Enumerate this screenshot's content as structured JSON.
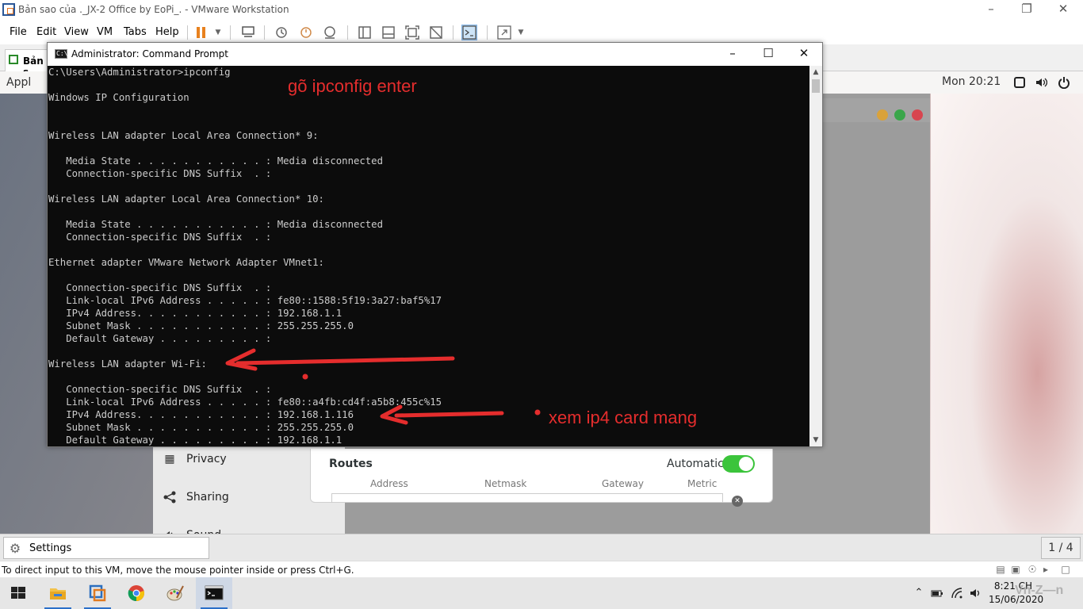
{
  "vmware": {
    "title": "Bản sao của ._JX-2 Office by EoPi_. - VMware Workstation",
    "menu": [
      "File",
      "Edit",
      "View",
      "VM",
      "Tabs",
      "Help"
    ],
    "vm_tab_label": "Bản s",
    "status_text": "To direct input to this VM, move the mouse pointer inside or press Ctrl+G."
  },
  "guest": {
    "activities": "Appl",
    "clock": "Mon 20:21",
    "settings": {
      "sidebar": [
        {
          "label": "Privacy",
          "icon": "privacy-icon"
        },
        {
          "label": "Sharing",
          "icon": "share-icon"
        },
        {
          "label": "Sound",
          "icon": "sound-icon"
        }
      ],
      "routes": {
        "title": "Routes",
        "automatic_label": "Automatic",
        "automatic_on": true,
        "columns": [
          "Address",
          "Netmask",
          "Gateway",
          "Metric"
        ]
      }
    },
    "taskbar": {
      "item_label": "Settings",
      "pager": "1 / 4"
    }
  },
  "cmd": {
    "title": "Administrator: Command Prompt",
    "lines": [
      "C:\\Users\\Administrator>ipconfig",
      "",
      "Windows IP Configuration",
      "",
      "",
      "Wireless LAN adapter Local Area Connection* 9:",
      "",
      "   Media State . . . . . . . . . . . : Media disconnected",
      "   Connection-specific DNS Suffix  . :",
      "",
      "Wireless LAN adapter Local Area Connection* 10:",
      "",
      "   Media State . . . . . . . . . . . : Media disconnected",
      "   Connection-specific DNS Suffix  . :",
      "",
      "Ethernet adapter VMware Network Adapter VMnet1:",
      "",
      "   Connection-specific DNS Suffix  . :",
      "   Link-local IPv6 Address . . . . . : fe80::1588:5f19:3a27:baf5%17",
      "   IPv4 Address. . . . . . . . . . . : 192.168.1.1",
      "   Subnet Mask . . . . . . . . . . . : 255.255.255.0",
      "   Default Gateway . . . . . . . . . :",
      "",
      "Wireless LAN adapter Wi-Fi:",
      "",
      "   Connection-specific DNS Suffix  . :",
      "   Link-local IPv6 Address . . . . . : fe80::a4fb:cd4f:a5b8:455c%15",
      "   IPv4 Address. . . . . . . . . . . : 192.168.1.116",
      "   Subnet Mask . . . . . . . . . . . : 255.255.255.0",
      "   Default Gateway . . . . . . . . . : 192.168.1.1"
    ]
  },
  "annotations": {
    "type_ipconfig": "gõ ipconfig enter",
    "view_ip4": "xem ip4 card mang",
    "color": "#e52d2d"
  },
  "windows": {
    "clock_time": "8:21 CH",
    "clock_date": "15/06/2020",
    "watermark": "Vn-Z—n",
    "taskbar_apps": [
      "start-icon",
      "file-explorer-icon",
      "vmware-icon",
      "chrome-icon",
      "paint-icon",
      "cmd-icon"
    ]
  }
}
